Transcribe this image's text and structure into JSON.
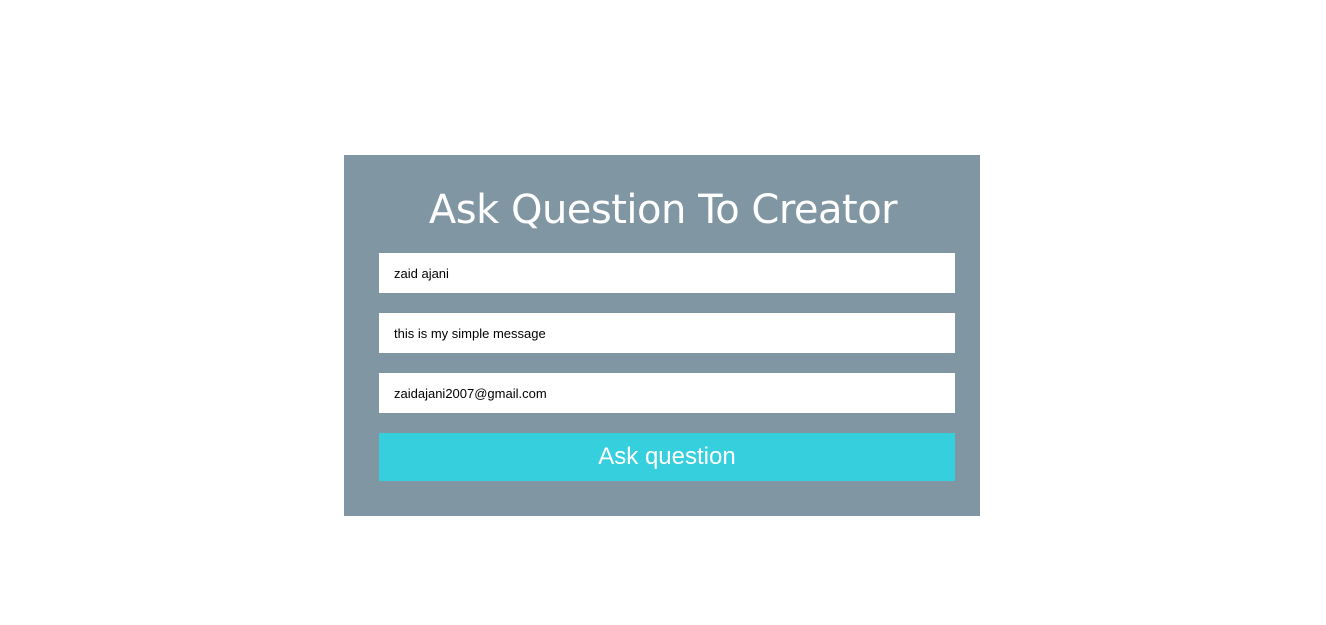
{
  "form": {
    "title": "Ask Question To Creator",
    "name_value": "zaid ajani",
    "message_value": "this is my simple message",
    "email_value": "zaidajani2007@gmail.com",
    "submit_label": "Ask question"
  },
  "colors": {
    "card_background": "#8196a3",
    "button_background": "#36cfdd",
    "text_light": "#ffffff"
  }
}
